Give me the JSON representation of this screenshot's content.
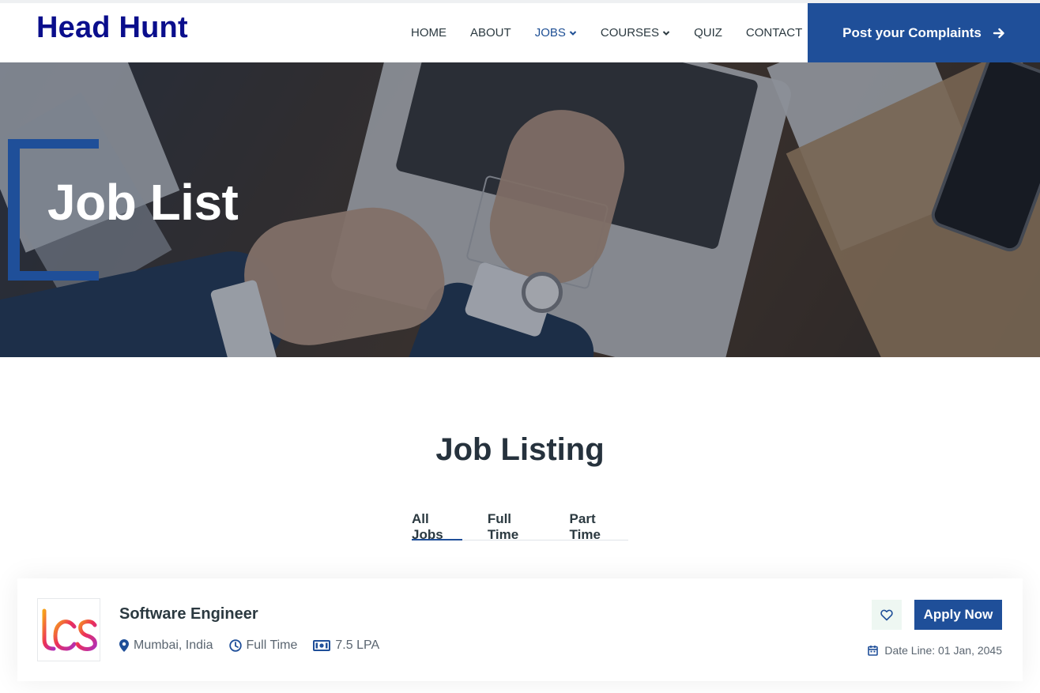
{
  "brand": {
    "name": "Head Hunt"
  },
  "nav": {
    "items": [
      {
        "label": "HOME"
      },
      {
        "label": "ABOUT"
      },
      {
        "label": "JOBS",
        "active": true,
        "dropdown": true
      },
      {
        "label": "COURSES",
        "dropdown": true
      },
      {
        "label": "QUIZ"
      },
      {
        "label": "CONTACT"
      }
    ],
    "cta": {
      "label": "Post your Complaints",
      "icon": "arrow-right-icon"
    }
  },
  "hero": {
    "title": "Job List"
  },
  "listing": {
    "title": "Job Listing",
    "tabs": [
      {
        "label": "All Jobs",
        "active": true
      },
      {
        "label": "Full Time"
      },
      {
        "label": "Part Time"
      }
    ],
    "jobs": [
      {
        "logo": "tcs",
        "title": "Software Engineer",
        "location": "Mumbai, India",
        "type": "Full Time",
        "salary": "7.5 LPA",
        "apply_label": "Apply Now",
        "deadline": "Date Line: 01 Jan, 2045"
      }
    ]
  },
  "colors": {
    "brand": "#0a0e8c",
    "accent": "#1f4f99",
    "text": "#2b3940",
    "muted": "#5a6570"
  }
}
